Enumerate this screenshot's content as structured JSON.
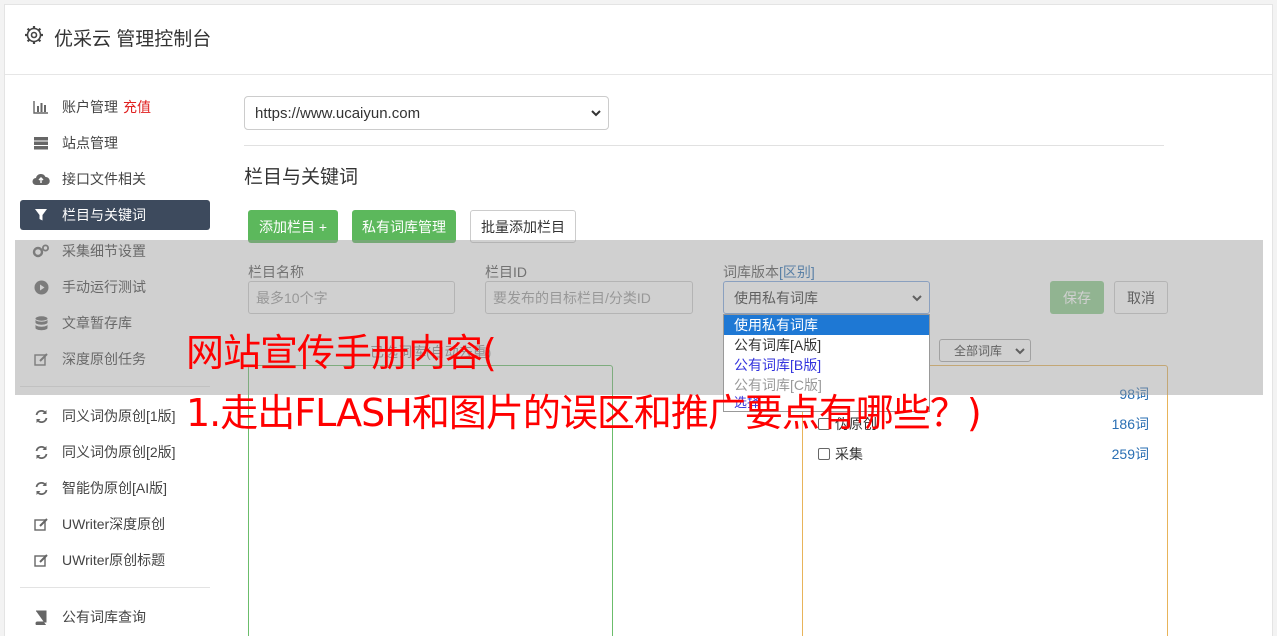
{
  "header": {
    "title": "优采云 管理控制台"
  },
  "sidebar": {
    "items": [
      {
        "label": "账户管理",
        "badge": "充值",
        "icon": "bar-chart-icon"
      },
      {
        "label": "站点管理",
        "icon": "server-icon"
      },
      {
        "label": "接口文件相关",
        "icon": "cloud-upload-icon"
      },
      {
        "label": "栏目与关键词",
        "icon": "filter-icon",
        "active": true
      },
      {
        "label": "采集细节设置",
        "icon": "cogs-icon"
      },
      {
        "label": "手动运行测试",
        "icon": "play-icon"
      },
      {
        "label": "文章暂存库",
        "icon": "database-icon"
      },
      {
        "label": "深度原创任务",
        "icon": "edit-icon"
      }
    ],
    "items2": [
      {
        "label": "同义词伪原创[1版]",
        "icon": "refresh-icon"
      },
      {
        "label": "同义词伪原创[2版]",
        "icon": "refresh-icon"
      },
      {
        "label": "智能伪原创[AI版]",
        "icon": "refresh-icon"
      },
      {
        "label": "UWriter深度原创",
        "icon": "edit-icon"
      },
      {
        "label": "UWriter原创标题",
        "icon": "edit-icon"
      }
    ],
    "items3": [
      {
        "label": "公有词库查询",
        "icon": "book-icon"
      }
    ]
  },
  "main": {
    "site_select": "https://www.ucaiyun.com",
    "section_title": "栏目与关键词",
    "buttons": {
      "add_column": "添加栏目 +",
      "private_lib": "私有词库管理",
      "batch_add": "批量添加栏目"
    },
    "form": {
      "col_name_label": "栏目名称",
      "col_name_placeholder": "最多10个字",
      "col_id_label": "栏目ID",
      "col_id_placeholder": "要发布的目标栏目/分类ID",
      "lib_version_label": "词库版本",
      "lib_version_link": "[区别]",
      "lib_version_value": "使用私有词库",
      "save": "保存",
      "cancel": "取消"
    },
    "dropdown_options": [
      "使用私有词库",
      "公有词库[A版]",
      "公有词库[B版]",
      "公有词库[C版]"
    ],
    "dropdown_hidden_tail": "选择",
    "hint": "已选词库(自动去重)",
    "lib_filter": "全部词库",
    "libs": [
      {
        "name": "",
        "count": "98词"
      },
      {
        "name": "伪原创",
        "count": "186词"
      },
      {
        "name": "采集",
        "count": "259词"
      }
    ]
  },
  "overlay_text": {
    "line1": "网站宣传手册内容(",
    "line2": "1.走出FLASH和图片的误区和推广要点有哪些？)"
  }
}
